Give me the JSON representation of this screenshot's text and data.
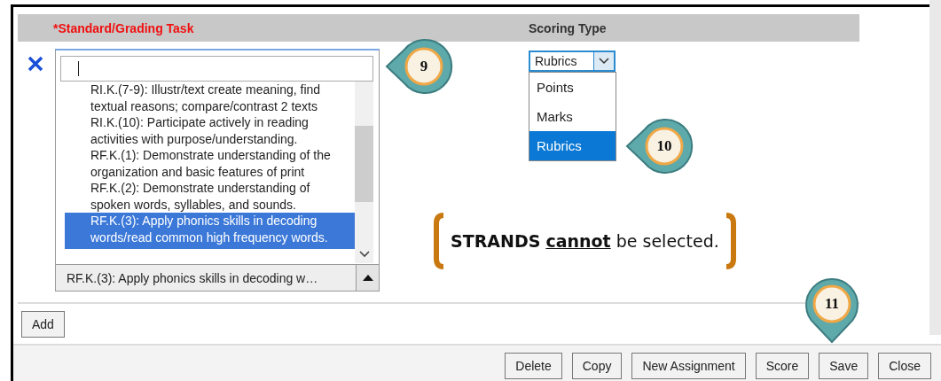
{
  "header": {
    "columns": [
      {
        "label": "*Standard/Grading Task",
        "required": true
      },
      {
        "label": "Scoring Type",
        "required": false
      }
    ]
  },
  "standard_picker": {
    "items": [
      {
        "label": "RI.K.(7-9): Illustr/text create meaning, find textual reasons; compare/contrast 2 texts",
        "selected": false
      },
      {
        "label": "RI.K.(10): Participate actively in reading activities with purpose/understanding.",
        "selected": false
      },
      {
        "label": "RF.K.(1): Demonstrate understanding of the organization and basic features of print",
        "selected": false
      },
      {
        "label": "RF.K.(2): Demonstrate understanding of spoken words, syllables, and sounds.",
        "selected": false
      },
      {
        "label": "RF.K.(3): Apply phonics skills in decoding words/read common high frequency words.",
        "selected": true
      }
    ],
    "current": "RF.K.(3): Apply phonics skills in decoding w…"
  },
  "scoring_type": {
    "value": "Rubrics",
    "options": [
      {
        "label": "Points",
        "selected": false
      },
      {
        "label": "Marks",
        "selected": false
      },
      {
        "label": "Rubrics",
        "selected": true
      }
    ]
  },
  "note": {
    "parts": [
      {
        "text": "STRANDS",
        "bold": true,
        "underline": false
      },
      {
        "text": "cannot",
        "bold": true,
        "underline": true
      },
      {
        "text": "be selected.",
        "bold": false,
        "underline": false
      }
    ]
  },
  "add_button": "Add",
  "footer_buttons": [
    "Delete",
    "Copy",
    "New Assignment",
    "Score",
    "Save",
    "Close"
  ],
  "callouts": [
    {
      "label": "9",
      "kind": "left"
    },
    {
      "label": "10",
      "kind": "left"
    },
    {
      "label": "11",
      "kind": "down"
    }
  ]
}
